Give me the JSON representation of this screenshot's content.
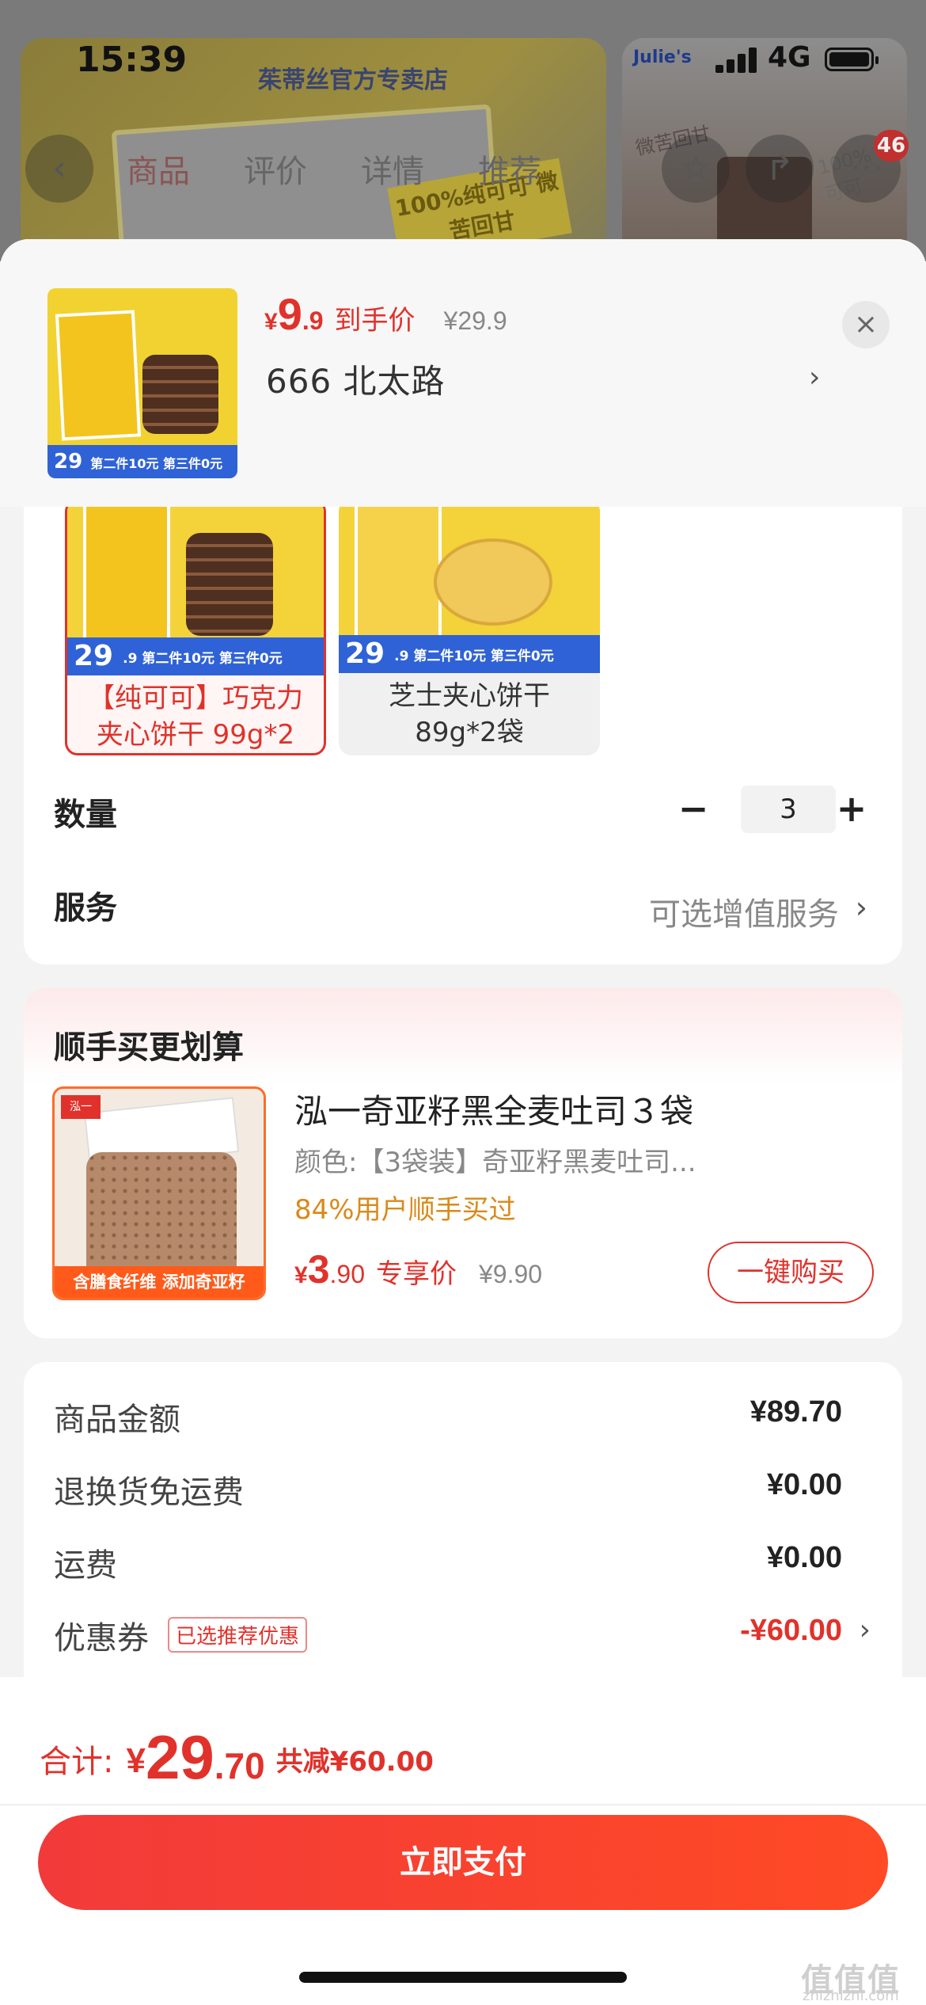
{
  "status_bar": {
    "time": "15:39",
    "network": "4G",
    "brand": "Julie's"
  },
  "background_page": {
    "shop_name": "茱蒂丝官方专卖店",
    "banner_slogan": "100%纯可可 微苦回甘",
    "side_text": "微苦回甘",
    "side_pct": "100% 纯可可",
    "nav_tabs": [
      "商品",
      "评价",
      "详情",
      "推荐"
    ],
    "cart_badge": "46",
    "icons": [
      "back-icon",
      "favorite-icon",
      "share-icon",
      "more-icon"
    ]
  },
  "sheet_header": {
    "thumb_strip_price": "29",
    "thumb_strip_dec": ".9",
    "thumb_strip_text": "第二件10元 第三件0元",
    "price_yen": "¥",
    "price_int": "9",
    "price_dec": ".9",
    "price_label": "到手价",
    "original_price": "¥29.9",
    "selected_spec": "666  北太路",
    "close_icon": "close-icon"
  },
  "options": [
    {
      "strip_price": "29",
      "strip_dec": ".9",
      "strip_text": "第二件10元 第三件0元",
      "name": "【纯可可】巧克力夹心饼干 99g*2",
      "selected": true
    },
    {
      "strip_price": "29",
      "strip_dec": ".9",
      "strip_text": "第二件10元 第三件0元",
      "name": "芝士夹心饼干 89g*2袋",
      "selected": false
    }
  ],
  "quantity": {
    "label": "数量",
    "value": "3",
    "minus": "−",
    "plus": "+"
  },
  "service": {
    "label": "服务",
    "value": "可选增值服务"
  },
  "bundle": {
    "title": "顺手买更划算",
    "image_bar": "含膳食纤维  添加奇亚籽",
    "image_logo": "泓一",
    "product_title": "泓一奇亚籽黑全麦吐司３袋",
    "product_spec": "颜色:【3袋装】奇亚籽黑麦吐司...",
    "product_note": "84%用户顺手买过",
    "price_yen": "¥",
    "price_int": "3",
    "price_dec": ".90",
    "price_label": "专享价",
    "original_price": "¥9.90",
    "buy_button": "一键购买"
  },
  "summary": [
    {
      "key": "商品金额",
      "value": "¥89.70"
    },
    {
      "key": "退换货免运费",
      "value": "¥0.00"
    },
    {
      "key": "运费",
      "value": "¥0.00"
    },
    {
      "key": "优惠券",
      "value": "-¥60.00",
      "tag": "已选推荐优惠"
    }
  ],
  "footer": {
    "total_label": "合计:",
    "total_yen": "¥",
    "total_int": "29",
    "total_dec": ".70",
    "saved": "共减¥60.00",
    "pay_button": "立即支付"
  },
  "watermark": {
    "main": "值值值",
    "sub": "zhizhizhi.com"
  },
  "colors": {
    "accent": "#e0322b",
    "note": "#d98a1a",
    "strip_blue": "#2f62d6"
  }
}
